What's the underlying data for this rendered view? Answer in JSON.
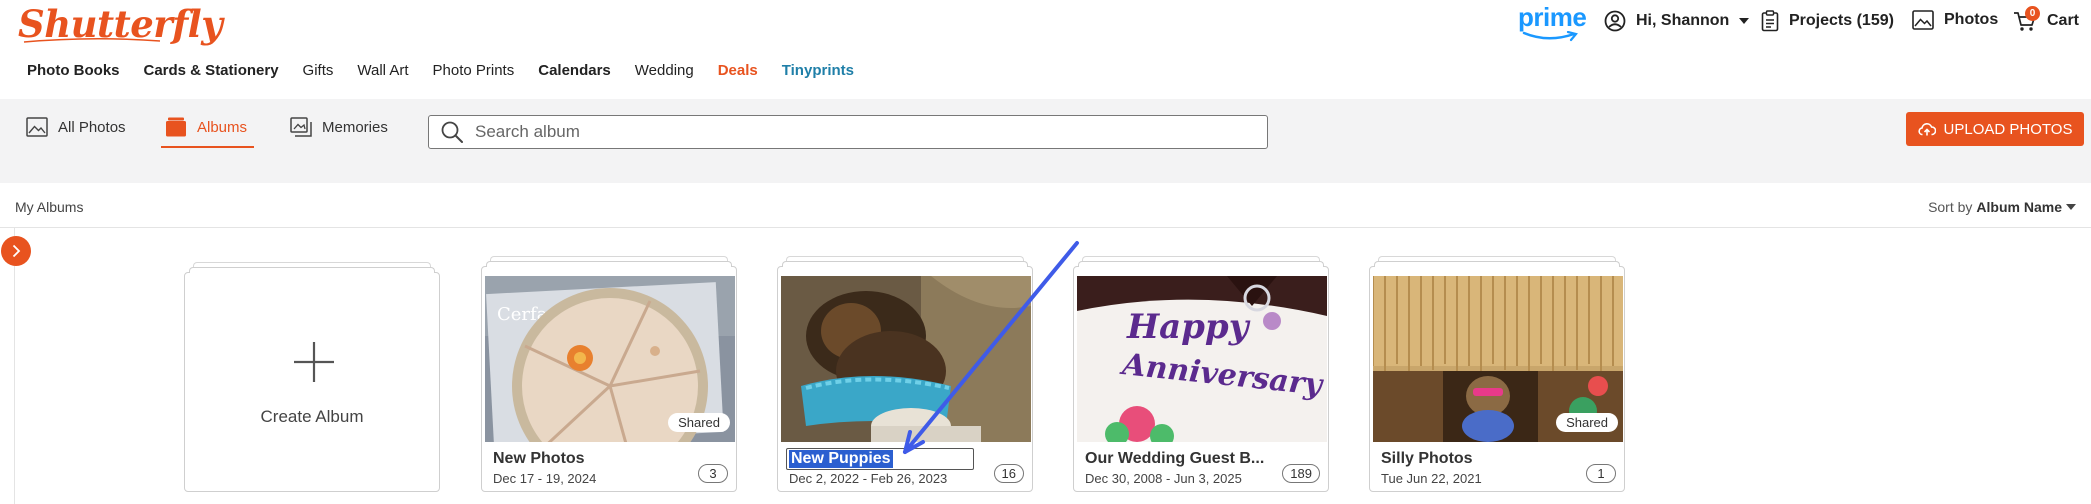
{
  "brand": {
    "logo": "Shutterfly",
    "prime": "prime",
    "accent": "#e8531f"
  },
  "utility": {
    "greeting": "Hi, Shannon",
    "projects": "Projects (159)",
    "photos": "Photos",
    "cart": "Cart",
    "cart_count": "0"
  },
  "category_nav": [
    {
      "label": "Photo Books"
    },
    {
      "label": "Cards & Stationery"
    },
    {
      "label": "Gifts"
    },
    {
      "label": "Wall Art"
    },
    {
      "label": "Photo Prints"
    },
    {
      "label": "Calendars"
    },
    {
      "label": "Wedding"
    },
    {
      "label": "Deals",
      "color": "#e8531f"
    },
    {
      "label": "Tinyprints",
      "color": "#1f7fa8"
    }
  ],
  "tabs": {
    "all_photos": "All Photos",
    "albums": "Albums",
    "memories": "Memories"
  },
  "search": {
    "placeholder": "Search album"
  },
  "upload_button": "UPLOAD PHOTOS",
  "section": {
    "title": "My Albums",
    "sort_prefix": "Sort by",
    "sort_value": "Album Name"
  },
  "create_album": "Create Album",
  "albums": [
    {
      "title": "New Photos",
      "dates": "Dec 17 - 19, 2024",
      "count": "3",
      "shared": "Shared"
    },
    {
      "title": "New Puppies",
      "dates": "Dec 2, 2022 - Feb 26, 2023",
      "count": "16"
    },
    {
      "title": "Our Wedding Guest B...",
      "dates": "Dec 30, 2008 - Jun 3, 2025",
      "count": "189"
    },
    {
      "title": "Silly Photos",
      "dates": "Tue Jun 22, 2021",
      "count": "1",
      "shared": "Shared"
    }
  ],
  "thumb_text": {
    "package_brand": "Cerfa",
    "cake_line1": "Happy",
    "cake_line2": "Anniversary"
  }
}
